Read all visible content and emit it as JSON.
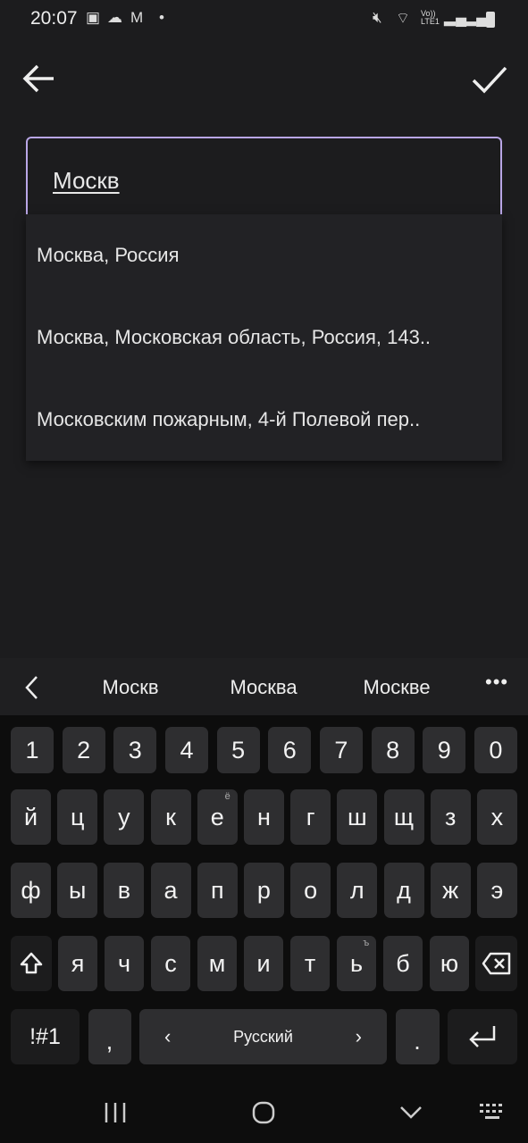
{
  "status": {
    "time": "20:07",
    "left_icons": [
      "gallery-icon",
      "cloud-icon",
      "gmail-icon",
      "dot-icon"
    ],
    "right_icons": [
      "mute-icon",
      "wifi-icon",
      "volte-icon",
      "signal-icon",
      "signal-icon",
      "battery-charging-icon"
    ],
    "volte_label": "Vo)) LTE1"
  },
  "toolbar": {
    "back": "arrow-left-icon",
    "confirm": "check-icon"
  },
  "field": {
    "value": "Москв",
    "border_color": "#b9a6e6"
  },
  "suggestions_dropdown": [
    "Москва, Россия",
    "Москва, Московская область, Россия, 143..",
    "Московским пожарным, 4-й Полевой пер.."
  ],
  "keyboard": {
    "predictions": [
      "Москв",
      "Москва",
      "Москве"
    ],
    "numbers": [
      "1",
      "2",
      "3",
      "4",
      "5",
      "6",
      "7",
      "8",
      "9",
      "0"
    ],
    "row1": [
      "й",
      "ц",
      "у",
      "к",
      "е",
      "н",
      "г",
      "ш",
      "щ",
      "з",
      "х"
    ],
    "row1_sup": {
      "е": "ё"
    },
    "row2": [
      "ф",
      "ы",
      "в",
      "а",
      "п",
      "р",
      "о",
      "л",
      "д",
      "ж",
      "э"
    ],
    "row3": [
      "я",
      "ч",
      "с",
      "м",
      "и",
      "т",
      "ь",
      "б",
      "ю"
    ],
    "row3_sup": {
      "ь": "ъ"
    },
    "symbols": "!#1",
    "comma": ",",
    "space": "Русский",
    "period": "."
  }
}
